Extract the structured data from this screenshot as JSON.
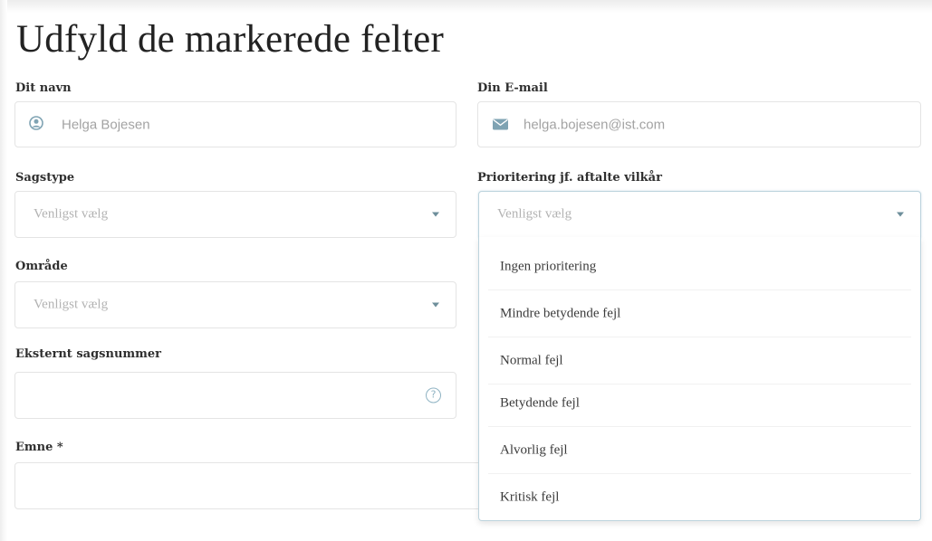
{
  "form": {
    "title": "Udfyld de markerede felter",
    "name_label": "Dit navn",
    "name_value": "Helga Bojesen",
    "email_label": "Din E-mail",
    "email_value": "helga.bojesen@ist.com",
    "casetype_label": "Sagstype",
    "casetype_placeholder": "Venligst vælg",
    "priority_label": "Prioritering jf. aftalte vilkår",
    "priority_placeholder": "Venligst vælg",
    "area_label": "Område",
    "area_placeholder": "Venligst vælg",
    "external_label": "Eksternt sagsnummer",
    "external_value": "",
    "subject_label": "Emne *",
    "subject_value": ""
  },
  "priority_options": [
    "Ingen prioritering",
    "Mindre betydende fejl",
    "Normal fejl",
    "Betydende fejl",
    "Alvorlig fejl",
    "Kritisk fejl"
  ],
  "icons": {
    "name_field": "user-circle-icon",
    "email_field": "envelope-icon",
    "select_arrow": "caret-down-icon",
    "help": "question-circle-icon"
  },
  "colors": {
    "accent": "#6e8f9b",
    "focus_border": "#bcd3dd",
    "help_icon": "#8fb3c3"
  }
}
